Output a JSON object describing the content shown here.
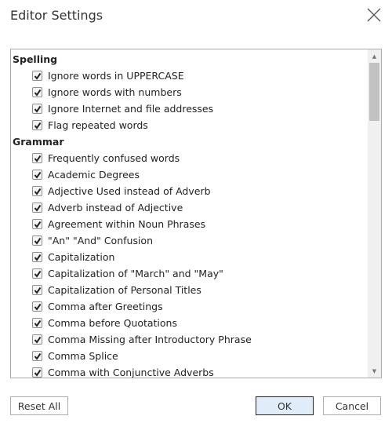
{
  "dialog": {
    "title": "Editor Settings",
    "close_icon": "close-icon"
  },
  "sections": [
    {
      "label": "Spelling",
      "items": [
        {
          "label": "Ignore words in UPPERCASE",
          "checked": true
        },
        {
          "label": "Ignore words with numbers",
          "checked": true
        },
        {
          "label": "Ignore Internet and file addresses",
          "checked": true
        },
        {
          "label": "Flag repeated words",
          "checked": true
        }
      ]
    },
    {
      "label": "Grammar",
      "items": [
        {
          "label": "Frequently confused words",
          "checked": true
        },
        {
          "label": "Academic Degrees",
          "checked": true
        },
        {
          "label": "Adjective Used instead of Adverb",
          "checked": true
        },
        {
          "label": "Adverb instead of Adjective",
          "checked": true
        },
        {
          "label": "Agreement within Noun Phrases",
          "checked": true
        },
        {
          "label": "\"An\" \"And\" Confusion",
          "checked": true
        },
        {
          "label": "Capitalization",
          "checked": true
        },
        {
          "label": "Capitalization of \"March\" and \"May\"",
          "checked": true
        },
        {
          "label": "Capitalization of Personal Titles",
          "checked": true
        },
        {
          "label": "Comma after Greetings",
          "checked": true
        },
        {
          "label": "Comma before Quotations",
          "checked": true
        },
        {
          "label": "Comma Missing after Introductory Phrase",
          "checked": true
        },
        {
          "label": "Comma Splice",
          "checked": true
        },
        {
          "label": "Comma with Conjunctive Adverbs",
          "checked": true
        }
      ]
    }
  ],
  "buttons": {
    "reset": "Reset All",
    "ok": "OK",
    "cancel": "Cancel"
  }
}
